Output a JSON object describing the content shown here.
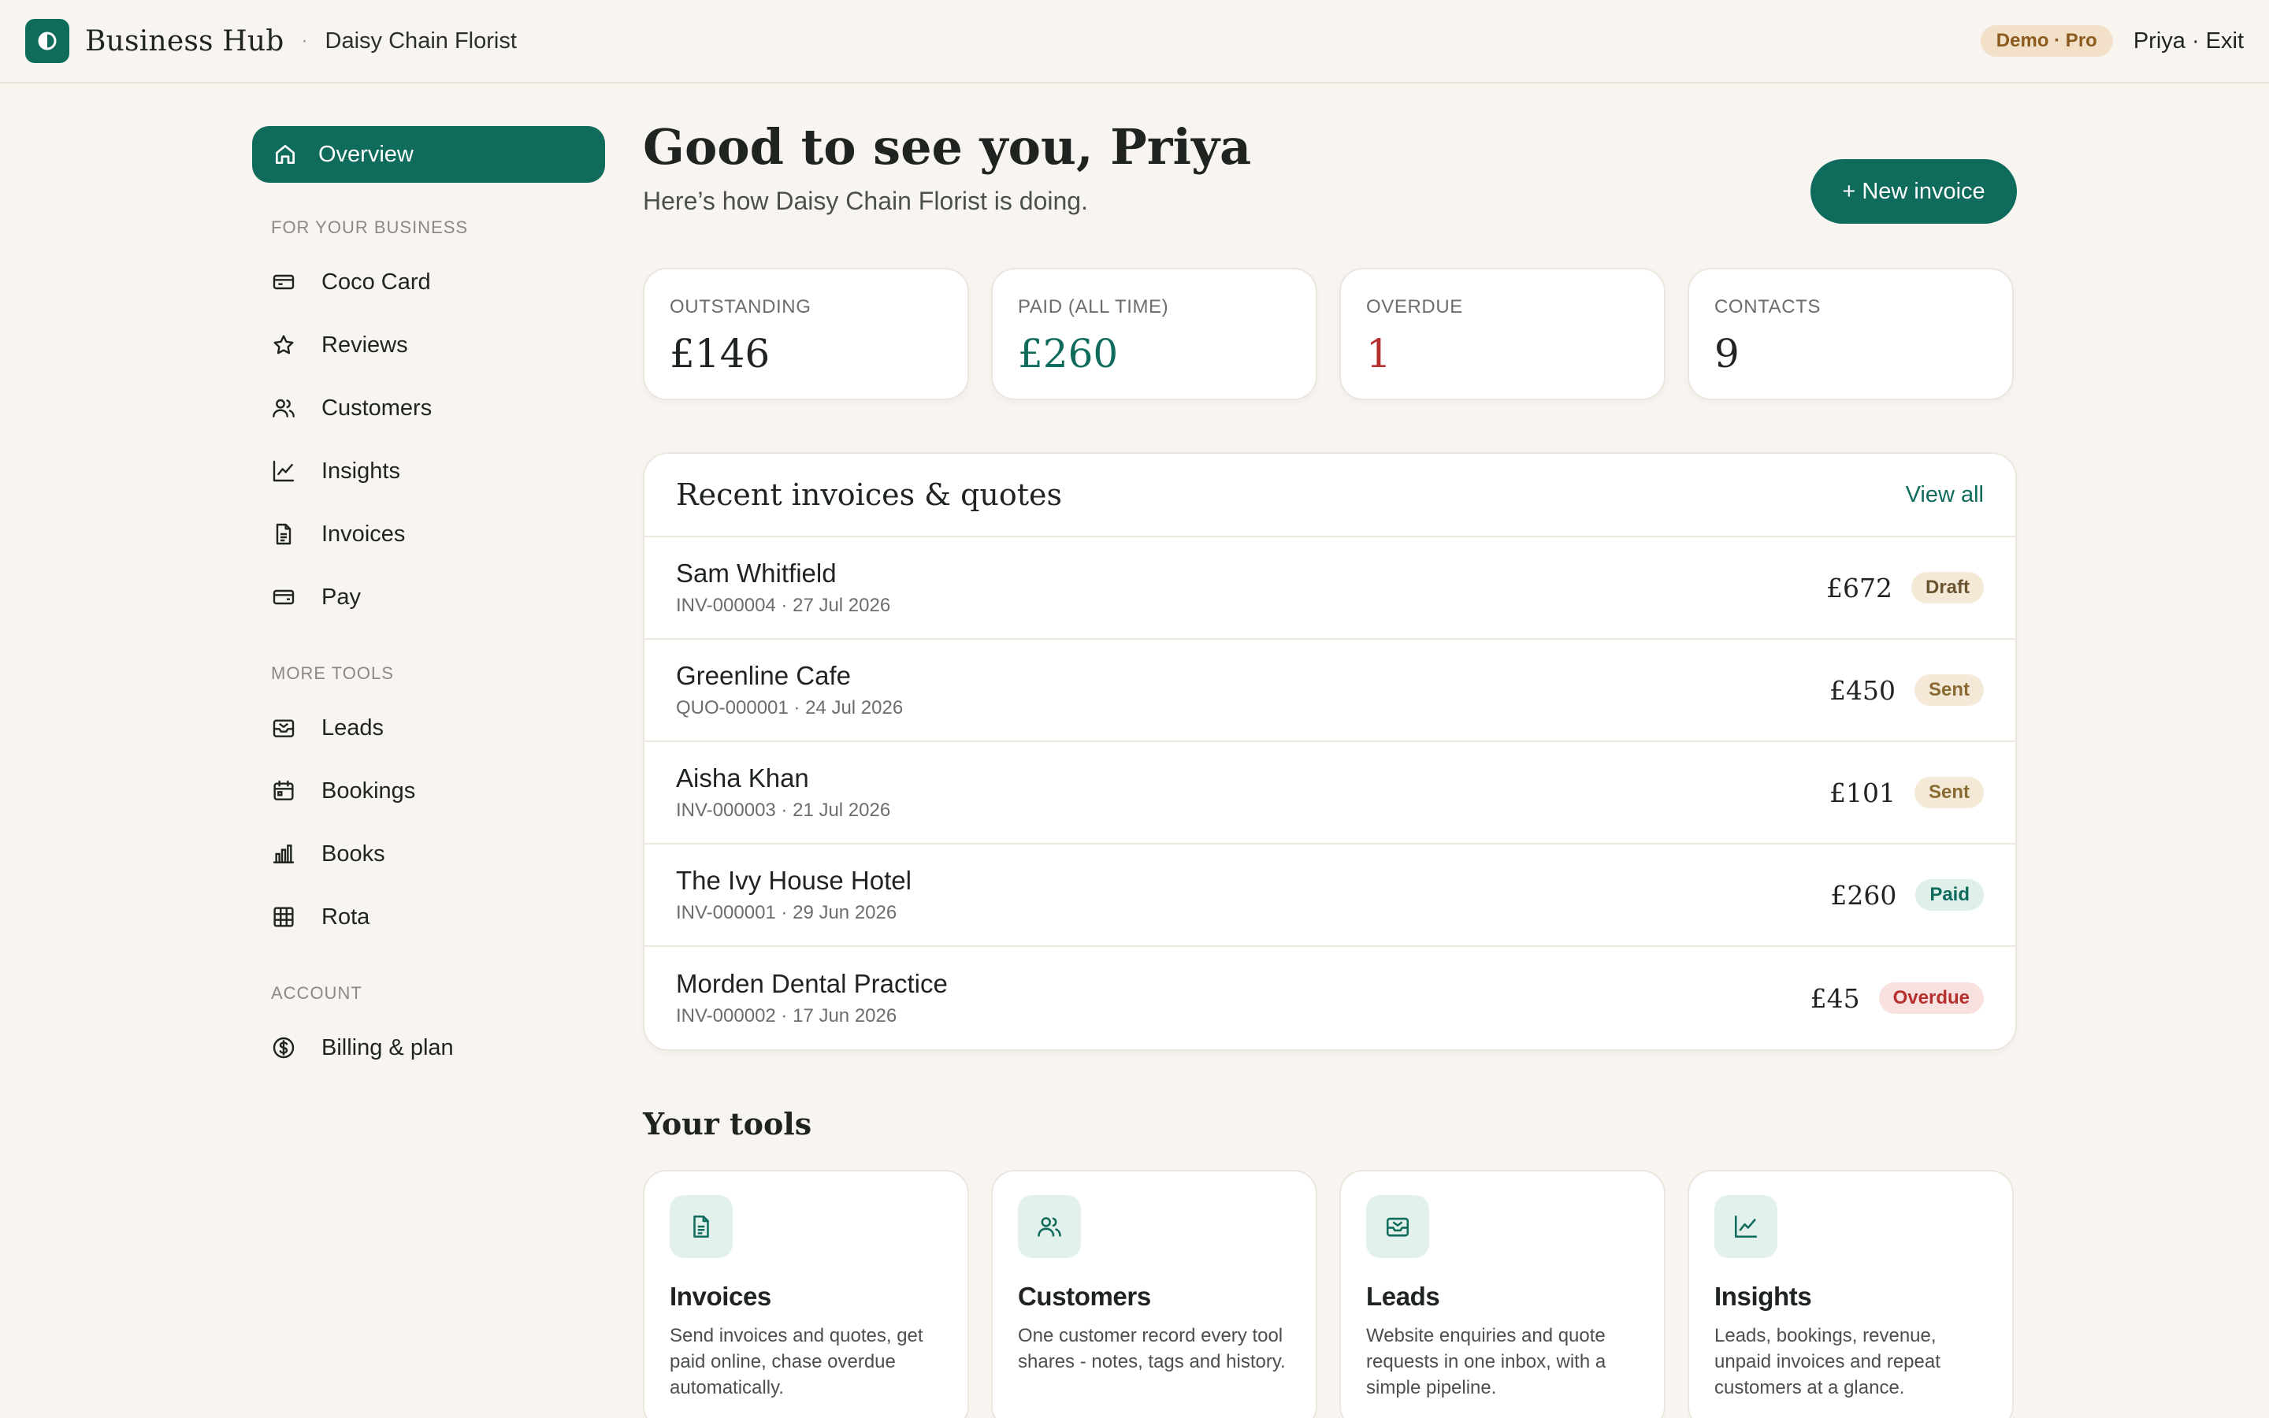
{
  "header": {
    "brand": "Business Hub",
    "separator": "·",
    "business_name": "Daisy Chain Florist",
    "plan_badge": "Demo · Pro",
    "user_exit": "Priya · Exit"
  },
  "sidebar": {
    "active_item": {
      "label": "Overview",
      "icon": "home-icon"
    },
    "sections": [
      {
        "title": "FOR YOUR BUSINESS",
        "items": [
          {
            "label": "Coco Card",
            "icon": "card-icon"
          },
          {
            "label": "Reviews",
            "icon": "star-icon"
          },
          {
            "label": "Customers",
            "icon": "users-icon"
          },
          {
            "label": "Insights",
            "icon": "chart-icon"
          },
          {
            "label": "Invoices",
            "icon": "document-icon"
          },
          {
            "label": "Pay",
            "icon": "credit-card-icon"
          }
        ]
      },
      {
        "title": "MORE TOOLS",
        "items": [
          {
            "label": "Leads",
            "icon": "inbox-icon"
          },
          {
            "label": "Bookings",
            "icon": "calendar-icon"
          },
          {
            "label": "Books",
            "icon": "bar-chart-icon"
          },
          {
            "label": "Rota",
            "icon": "grid-icon"
          }
        ]
      },
      {
        "title": "ACCOUNT",
        "items": [
          {
            "label": "Billing & plan",
            "icon": "dollar-circle-icon"
          }
        ]
      }
    ]
  },
  "main": {
    "greeting": "Good to see you, Priya",
    "subgreeting": "Here’s how Daisy Chain Florist is doing.",
    "new_invoice_label": "+ New invoice",
    "stats": [
      {
        "label": "OUTSTANDING",
        "value": "£146",
        "color": "#1f2421"
      },
      {
        "label": "PAID (ALL TIME)",
        "value": "£260",
        "color": "#0f6b5c"
      },
      {
        "label": "OVERDUE",
        "value": "1",
        "color": "#b3302f"
      },
      {
        "label": "CONTACTS",
        "value": "9",
        "color": "#1f2421"
      }
    ],
    "recent": {
      "title": "Recent invoices & quotes",
      "view_all": "View all",
      "rows": [
        {
          "name": "Sam Whitfield",
          "meta": "INV-000004 · 27 Jul 2026",
          "amount": "£672",
          "status": "Draft"
        },
        {
          "name": "Greenline Cafe",
          "meta": "QUO-000001 · 24 Jul 2026",
          "amount": "£450",
          "status": "Sent"
        },
        {
          "name": "Aisha Khan",
          "meta": "INV-000003 · 21 Jul 2026",
          "amount": "£101",
          "status": "Sent"
        },
        {
          "name": "The Ivy House Hotel",
          "meta": "INV-000001 · 29 Jun 2026",
          "amount": "£260",
          "status": "Paid"
        },
        {
          "name": "Morden Dental Practice",
          "meta": "INV-000002 · 17 Jun 2026",
          "amount": "£45",
          "status": "Overdue"
        }
      ]
    },
    "status_styles": {
      "Draft": {
        "bg": "#f3e9d6",
        "fg": "#6b5430"
      },
      "Sent": {
        "bg": "#f3e9d6",
        "fg": "#8a6a34"
      },
      "Paid": {
        "bg": "#dff0ea",
        "fg": "#0f6b5c"
      },
      "Overdue": {
        "bg": "#f8e1df",
        "fg": "#b3302f"
      }
    },
    "tools_title": "Your tools",
    "tools": [
      {
        "name": "Invoices",
        "icon": "document-icon",
        "desc": "Send invoices and quotes, get paid online, chase overdue automatically."
      },
      {
        "name": "Customers",
        "icon": "users-icon",
        "desc": "One customer record every tool shares - notes, tags and history."
      },
      {
        "name": "Leads",
        "icon": "inbox-icon",
        "desc": "Website enquiries and quote requests in one inbox, with a simple pipeline."
      },
      {
        "name": "Insights",
        "icon": "chart-icon",
        "desc": "Leads, bookings, revenue, unpaid invoices and repeat customers at a glance."
      }
    ]
  }
}
